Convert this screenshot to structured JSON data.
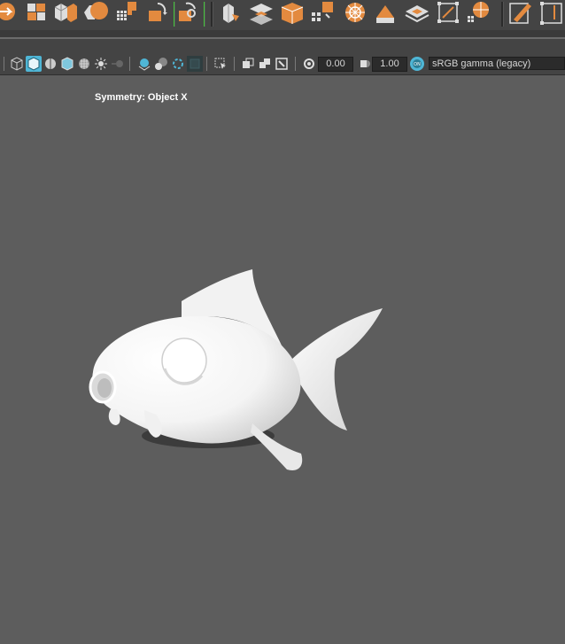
{
  "shelf": {
    "icons": [
      "poly-tool-icon",
      "cube-split-icon",
      "bevel-icon",
      "bridge-icon",
      "grid-fill-icon",
      "reduce-icon",
      "retopo-icon",
      "extrude-icon",
      "extract-icon",
      "collapse-icon",
      "boolean-icon",
      "separate-icon",
      "sphere-proj-icon",
      "bevel-face-icon",
      "layout-uv-icon",
      "bounding-box-icon",
      "uv-sphere-icon",
      "multicut-icon",
      "quad-draw-icon"
    ]
  },
  "viewport_toolbar": {
    "exposure_value": "0.00",
    "gamma_value": "1.00",
    "color_space": "sRGB gamma (legacy)",
    "colors": {
      "accent": "#4fb6d6",
      "orange": "#e38a3f"
    }
  },
  "viewport": {
    "symmetry_label": "Symmetry: Object X",
    "background": "#5d5d5d"
  }
}
